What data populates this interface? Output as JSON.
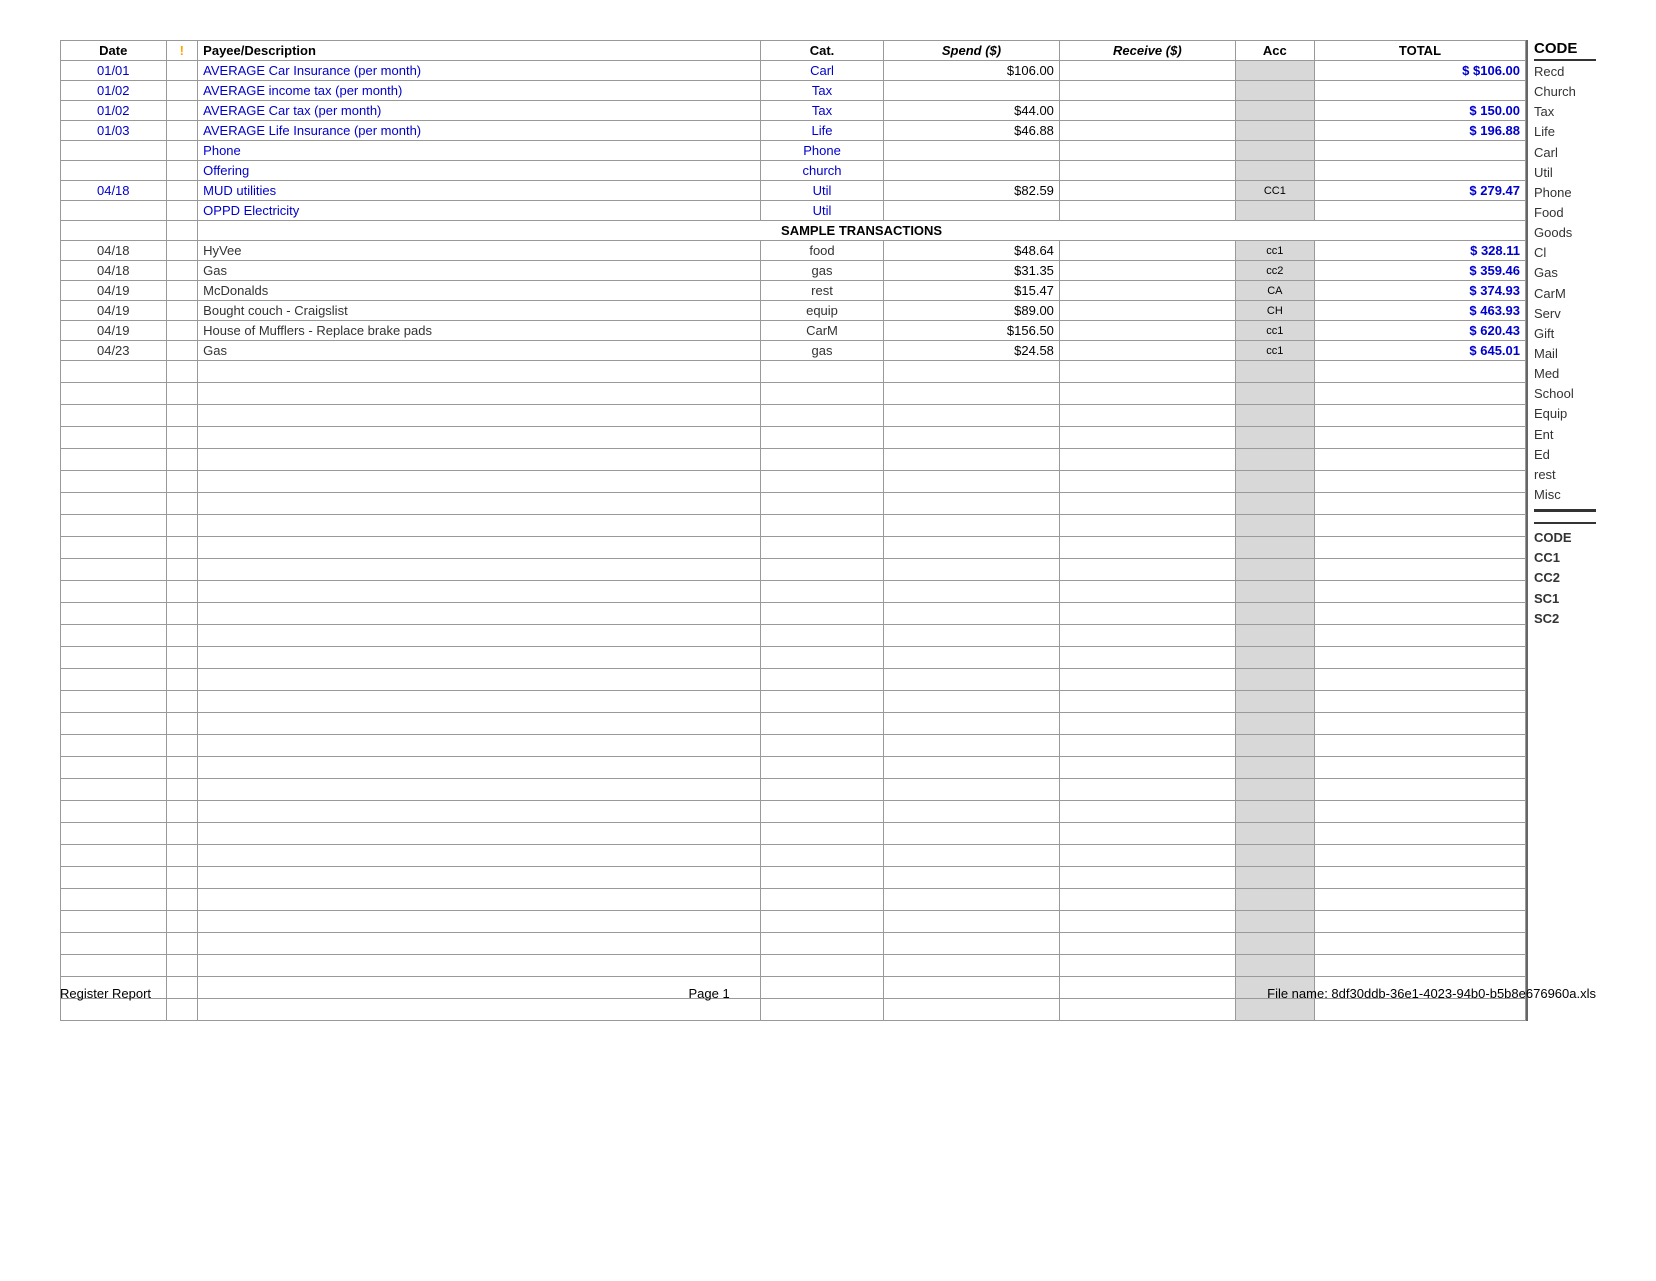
{
  "header": {
    "columns": {
      "date": "Date",
      "exclamation": "!",
      "payee": "Payee/Description",
      "cat": "Cat.",
      "spend": "Spend ($)",
      "receive": "Receive ($)",
      "acc": "Acc",
      "total": "TOTAL",
      "code": "CODE"
    }
  },
  "rows": [
    {
      "date": "01/01",
      "payee": "AVERAGE Car Insurance (per month)",
      "cat": "Carl",
      "spend": "$106.00",
      "receive": "",
      "acc": "",
      "total": "$106.00",
      "has_total": true,
      "blue": true
    },
    {
      "date": "01/02",
      "payee": "AVERAGE income tax (per month)",
      "cat": "Tax",
      "spend": "",
      "receive": "",
      "acc": "",
      "total": "",
      "has_total": false,
      "blue": true
    },
    {
      "date": "01/02",
      "payee": "AVERAGE Car tax (per month)",
      "cat": "Tax",
      "spend": "$44.00",
      "receive": "",
      "acc": "",
      "total": "150.00",
      "has_total": true,
      "blue": true
    },
    {
      "date": "01/03",
      "payee": "AVERAGE Life Insurance (per month)",
      "cat": "Life",
      "spend": "$46.88",
      "receive": "",
      "acc": "",
      "total": "196.88",
      "has_total": true,
      "blue": true
    },
    {
      "date": "",
      "payee": "Phone",
      "cat": "Phone",
      "spend": "",
      "receive": "",
      "acc": "",
      "total": "",
      "has_total": false,
      "blue": true
    },
    {
      "date": "",
      "payee": "Offering",
      "cat": "church",
      "spend": "",
      "receive": "",
      "acc": "",
      "total": "",
      "has_total": false,
      "blue": true
    },
    {
      "date": "04/18",
      "payee": "MUD utilities",
      "cat": "Util",
      "spend": "$82.59",
      "receive": "",
      "acc": "CC1",
      "total": "279.47",
      "has_total": true,
      "blue": true
    },
    {
      "date": "",
      "payee": "OPPD Electricity",
      "cat": "Util",
      "spend": "",
      "receive": "",
      "acc": "",
      "total": "",
      "has_total": false,
      "blue": true
    },
    {
      "date": "",
      "payee": "SAMPLE TRANSACTIONS",
      "cat": "",
      "spend": "",
      "receive": "",
      "acc": "",
      "total": "",
      "sample": true
    },
    {
      "date": "04/18",
      "payee": "HyVee",
      "cat": "food",
      "spend": "$48.64",
      "receive": "",
      "acc": "cc1",
      "total": "328.11",
      "has_total": true,
      "blue": false
    },
    {
      "date": "04/18",
      "payee": "Gas",
      "cat": "gas",
      "spend": "$31.35",
      "receive": "",
      "acc": "cc2",
      "total": "359.46",
      "has_total": true,
      "blue": false
    },
    {
      "date": "04/19",
      "payee": "McDonalds",
      "cat": "rest",
      "spend": "$15.47",
      "receive": "",
      "acc": "CA",
      "total": "374.93",
      "has_total": true,
      "blue": false
    },
    {
      "date": "04/19",
      "payee": "Bought couch - Craigslist",
      "cat": "equip",
      "spend": "$89.00",
      "receive": "",
      "acc": "CH",
      "total": "463.93",
      "has_total": true,
      "blue": false
    },
    {
      "date": "04/19",
      "payee": "House of Mufflers - Replace brake pads",
      "cat": "CarM",
      "spend": "$156.50",
      "receive": "",
      "acc": "cc1",
      "total": "620.43",
      "has_total": true,
      "blue": false
    },
    {
      "date": "04/23",
      "payee": "Gas",
      "cat": "gas",
      "spend": "$24.58",
      "receive": "",
      "acc": "cc1",
      "total": "645.01",
      "has_total": true,
      "blue": false
    }
  ],
  "empty_rows": 30,
  "code_list": {
    "header": "CODE",
    "items": [
      "Recd",
      "Church",
      "Tax",
      "Life",
      "Carl",
      "Util",
      "Phone",
      "Food",
      "Goods",
      "Cl",
      "Gas",
      "CarM",
      "Serv",
      "Gift",
      "Mail",
      "Med",
      "School",
      "Equip",
      "Ent",
      "Ed",
      "rest",
      "Misc"
    ],
    "bottom_items": [
      "CODE",
      "CC1",
      "CC2",
      "SC1",
      "SC2"
    ]
  },
  "footer": {
    "left": "Register Report",
    "center": "Page 1",
    "right": "File name: 8df30ddb-36e1-4023-94b0-b5b8e676960a.xls"
  }
}
